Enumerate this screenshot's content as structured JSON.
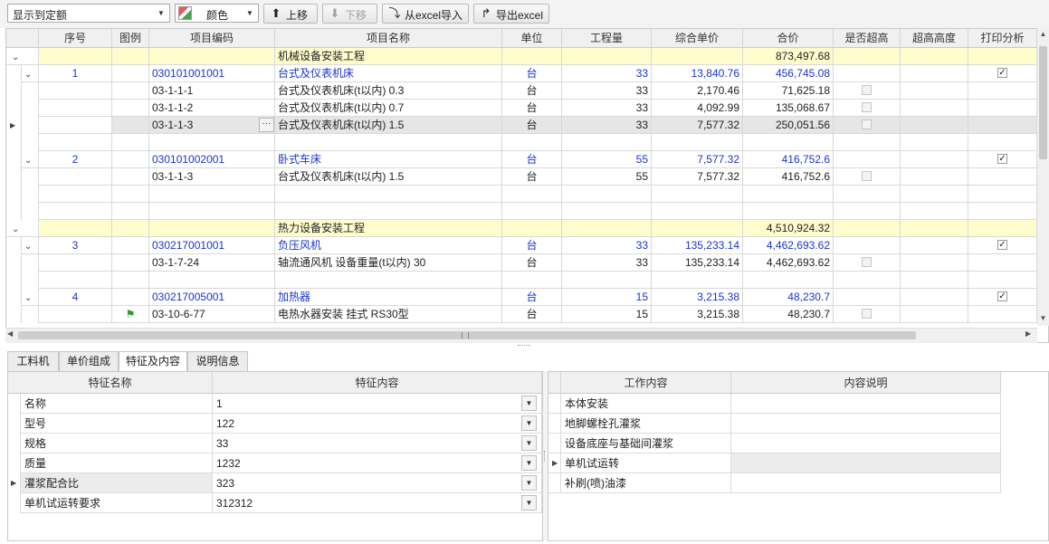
{
  "toolbar": {
    "display_select": "显示到定额",
    "color_select": "颜色",
    "move_up": "上移",
    "move_down": "下移",
    "import_excel": "从excel导入",
    "export_excel": "导出excel"
  },
  "grid": {
    "columns": [
      "序号",
      "图例",
      "项目编码",
      "项目名称",
      "单位",
      "工程量",
      "综合单价",
      "合价",
      "是否超高",
      "超高高度",
      "打印分析"
    ],
    "rows": [
      {
        "type": "group",
        "name": "机械设备安装工程",
        "total": "873,497.68"
      },
      {
        "type": "item",
        "seq": "1",
        "code": "030101001001",
        "name": "台式及仪表机床",
        "unit": "台",
        "qty": "33",
        "price": "13,840.76",
        "total": "456,745.08",
        "print": true
      },
      {
        "type": "norm",
        "code": "03-1-1-1",
        "name": "台式及仪表机床(t以内) 0.3",
        "unit": "台",
        "qty": "33",
        "price": "2,170.46",
        "total": "71,625.18"
      },
      {
        "type": "norm",
        "code": "03-1-1-2",
        "name": "台式及仪表机床(t以内) 0.7",
        "unit": "台",
        "qty": "33",
        "price": "4,092.99",
        "total": "135,068.67"
      },
      {
        "type": "norm",
        "code": "03-1-1-3",
        "name": "台式及仪表机床(t以内) 1.5",
        "unit": "台",
        "qty": "33",
        "price": "7,577.32",
        "total": "250,051.56",
        "selected": true
      },
      {
        "type": "blank"
      },
      {
        "type": "item",
        "seq": "2",
        "code": "030101002001",
        "name": "卧式车床",
        "unit": "台",
        "qty": "55",
        "price": "7,577.32",
        "total": "416,752.6",
        "print": true
      },
      {
        "type": "norm",
        "code": "03-1-1-3",
        "name": "台式及仪表机床(t以内) 1.5",
        "unit": "台",
        "qty": "55",
        "price": "7,577.32",
        "total": "416,752.6"
      },
      {
        "type": "blank"
      },
      {
        "type": "blank"
      },
      {
        "type": "group",
        "name": "热力设备安装工程",
        "total": "4,510,924.32"
      },
      {
        "type": "item",
        "seq": "3",
        "code": "030217001001",
        "name": "负压风机",
        "unit": "台",
        "qty": "33",
        "price": "135,233.14",
        "total": "4,462,693.62",
        "print": true
      },
      {
        "type": "norm",
        "code": "03-1-7-24",
        "name": "轴流通风机 设备重量(t以内) 30",
        "unit": "台",
        "qty": "33",
        "price": "135,233.14",
        "total": "4,462,693.62"
      },
      {
        "type": "blank"
      },
      {
        "type": "item",
        "seq": "4",
        "code": "030217005001",
        "name": "加热器",
        "unit": "台",
        "qty": "15",
        "price": "3,215.38",
        "total": "48,230.7",
        "print": true
      },
      {
        "type": "norm",
        "code": "03-10-6-77",
        "name": "电热水器安装 挂式 RS30型",
        "unit": "台",
        "qty": "15",
        "price": "3,215.38",
        "total": "48,230.7",
        "flag": true
      }
    ]
  },
  "tabs": [
    "工料机",
    "单价组成",
    "特征及内容",
    "说明信息"
  ],
  "active_tab": 2,
  "features": {
    "headers": [
      "特征名称",
      "特征内容"
    ],
    "rows": [
      {
        "name": "名称",
        "value": "1"
      },
      {
        "name": "型号",
        "value": "122"
      },
      {
        "name": "规格",
        "value": "33"
      },
      {
        "name": "质量",
        "value": "1232"
      },
      {
        "name": "灌浆配合比",
        "value": "323"
      },
      {
        "name": "单机试运转要求",
        "value": "312312"
      }
    ]
  },
  "work": {
    "headers": [
      "工作内容",
      "内容说明"
    ],
    "rows": [
      {
        "name": "本体安装",
        "desc": ""
      },
      {
        "name": "地脚螺栓孔灌浆",
        "desc": ""
      },
      {
        "name": "设备底座与基础间灌浆",
        "desc": ""
      },
      {
        "name": "单机试运转",
        "desc": ""
      },
      {
        "name": "补刷(喷)油漆",
        "desc": ""
      }
    ]
  }
}
